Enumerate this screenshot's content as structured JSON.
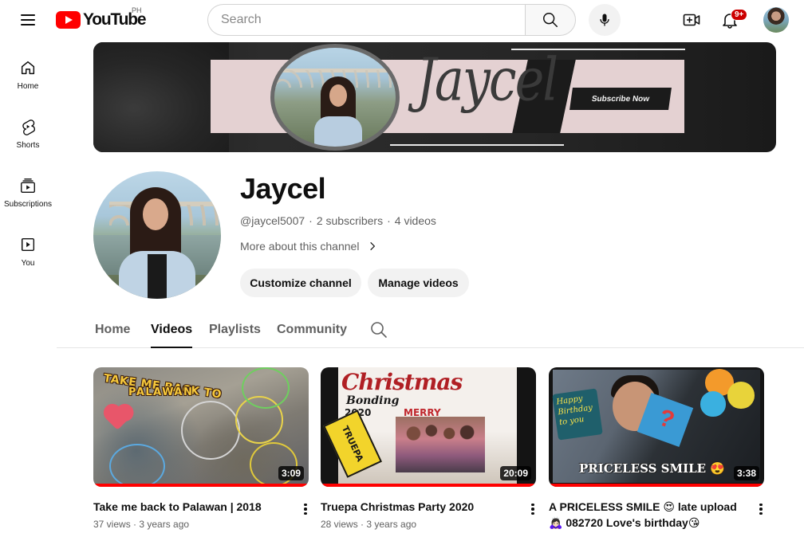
{
  "topbar": {
    "logo_text": "YouTube",
    "country_code": "PH",
    "search_placeholder": "Search",
    "notification_count": "9+",
    "icons": [
      "menu-icon",
      "search-icon",
      "mic-icon",
      "create-icon",
      "bell-icon"
    ]
  },
  "sidenav": {
    "items": [
      {
        "label": "Home",
        "icon": "home-icon"
      },
      {
        "label": "Shorts",
        "icon": "shorts-icon"
      },
      {
        "label": "Subscriptions",
        "icon": "subscriptions-icon"
      },
      {
        "label": "You",
        "icon": "you-icon"
      }
    ]
  },
  "banner": {
    "script_text": "Jaycel",
    "subscribe_text": "Subscribe Now"
  },
  "channel": {
    "name": "Jaycel",
    "handle": "@jaycel5007",
    "subscribers": "2 subscribers",
    "videos": "4 videos",
    "separator": "·",
    "about_label": "More about this channel",
    "customize_label": "Customize channel",
    "manage_label": "Manage videos"
  },
  "tabs": [
    {
      "label": "Home",
      "active": false
    },
    {
      "label": "Videos",
      "active": true
    },
    {
      "label": "Playlists",
      "active": false
    },
    {
      "label": "Community",
      "active": false
    }
  ],
  "videos": [
    {
      "title": "Take me back to Palawan | 2018",
      "views": "37 views",
      "age": "3 years ago",
      "duration": "3:09",
      "thumb_text_1": "TAKE ME BACK TO",
      "thumb_text_2": "PALAWAN"
    },
    {
      "title": "Truepa Christmas Party 2020",
      "views": "28 views",
      "age": "3 years ago",
      "duration": "20:09",
      "thumb_text_1": "Christmas",
      "thumb_text_2": "Bonding",
      "thumb_text_3": "2020",
      "thumb_text_4": "TRUEPA",
      "thumb_text_5": "MERRY"
    },
    {
      "title": "A PRICELESS SMILE 😍 late upload 🙇🏻‍♀️ 082720 Love's birthday😘",
      "views": "",
      "age": "",
      "duration": "3:38",
      "thumb_text_1": "Happy Birthday to you",
      "thumb_text_2": "PRICELESS SMILE 😍"
    }
  ],
  "colors": {
    "brand_red": "#ff0000",
    "text_primary": "#0f0f0f",
    "text_secondary": "#606060",
    "chip_bg": "#f2f2f2",
    "badge_red": "#cc0000"
  }
}
